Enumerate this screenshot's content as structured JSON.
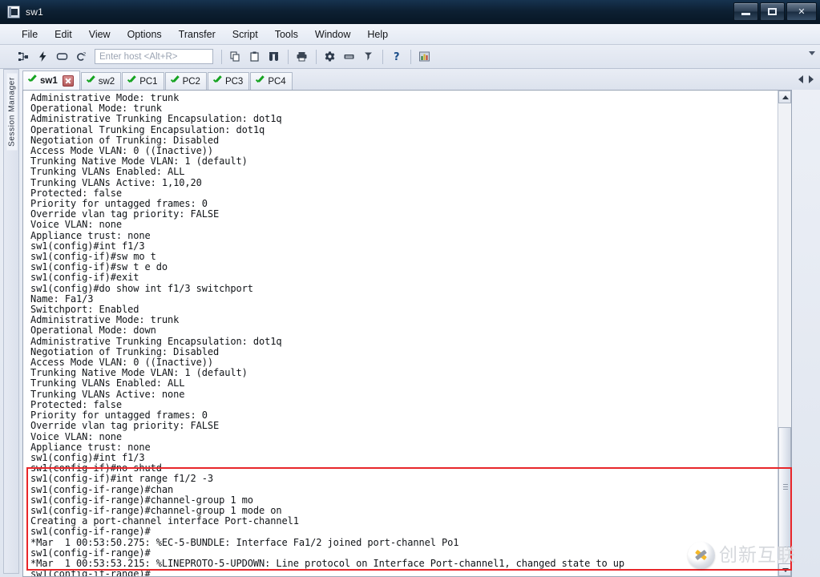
{
  "window": {
    "title": "sw1",
    "icon": "terminal-window-icon",
    "controls": {
      "minimize": "Minimize",
      "maximize": "Maximize",
      "close": "Close"
    }
  },
  "menubar": {
    "items": [
      "File",
      "Edit",
      "View",
      "Options",
      "Transfer",
      "Script",
      "Tools",
      "Window",
      "Help"
    ]
  },
  "toolbar": {
    "buttons": [
      {
        "name": "connect-icon",
        "glyph": "connect"
      },
      {
        "name": "quick-connect-icon",
        "glyph": "bolt"
      },
      {
        "name": "connect-in-tab-icon",
        "glyph": "tab-rect"
      },
      {
        "name": "reconnect-icon",
        "glyph": "c2"
      }
    ],
    "host_input": {
      "placeholder": "Enter host <Alt+R>",
      "value": ""
    },
    "right_buttons": [
      {
        "name": "copy-icon",
        "glyph": "copy"
      },
      {
        "name": "paste-icon",
        "glyph": "paste"
      },
      {
        "name": "find-icon",
        "glyph": "binoculars"
      },
      {
        "name": "print-icon",
        "glyph": "printer"
      },
      {
        "name": "settings-icon",
        "glyph": "gear"
      },
      {
        "name": "keymap-icon",
        "glyph": "keyboard"
      },
      {
        "name": "filter-icon",
        "glyph": "key"
      },
      {
        "name": "help-icon",
        "glyph": "question"
      },
      {
        "name": "session-options-icon",
        "glyph": "chart"
      }
    ],
    "overflow": "toolbar-overflow-arrow"
  },
  "sidebar": {
    "label": "Session Manager"
  },
  "tabs": {
    "items": [
      {
        "label": "sw1",
        "active": true,
        "status": "connected",
        "closable": true
      },
      {
        "label": "sw2",
        "active": false,
        "status": "connected",
        "closable": false
      },
      {
        "label": "PC1",
        "active": false,
        "status": "connected",
        "closable": false
      },
      {
        "label": "PC2",
        "active": false,
        "status": "connected",
        "closable": false
      },
      {
        "label": "PC3",
        "active": false,
        "status": "connected",
        "closable": false
      },
      {
        "label": "PC4",
        "active": false,
        "status": "connected",
        "closable": false
      }
    ],
    "nav_prev": "previous-tab",
    "nav_next": "next-tab"
  },
  "terminal": {
    "lines": [
      "Administrative Mode: trunk",
      "Operational Mode: trunk",
      "Administrative Trunking Encapsulation: dot1q",
      "Operational Trunking Encapsulation: dot1q",
      "Negotiation of Trunking: Disabled",
      "Access Mode VLAN: 0 ((Inactive))",
      "Trunking Native Mode VLAN: 1 (default)",
      "Trunking VLANs Enabled: ALL",
      "Trunking VLANs Active: 1,10,20",
      "Protected: false",
      "Priority for untagged frames: 0",
      "Override vlan tag priority: FALSE",
      "Voice VLAN: none",
      "Appliance trust: none",
      "sw1(config)#int f1/3",
      "sw1(config-if)#sw mo t",
      "sw1(config-if)#sw t e do",
      "sw1(config-if)#exit",
      "sw1(config)#do show int f1/3 switchport",
      "Name: Fa1/3",
      "Switchport: Enabled",
      "Administrative Mode: trunk",
      "Operational Mode: down",
      "Administrative Trunking Encapsulation: dot1q",
      "Negotiation of Trunking: Disabled",
      "Access Mode VLAN: 0 ((Inactive))",
      "Trunking Native Mode VLAN: 1 (default)",
      "Trunking VLANs Enabled: ALL",
      "Trunking VLANs Active: none",
      "Protected: false",
      "Priority for untagged frames: 0",
      "Override vlan tag priority: FALSE",
      "Voice VLAN: none",
      "Appliance trust: none",
      "sw1(config)#int f1/3",
      "sw1(config-if)#no shutd",
      "sw1(config-if)#int range f1/2 -3",
      "sw1(config-if-range)#chan",
      "sw1(config-if-range)#channel-group 1 mo",
      "sw1(config-if-range)#channel-group 1 mode on",
      "Creating a port-channel interface Port-channel1",
      "sw1(config-if-range)#",
      "*Mar  1 00:53:50.275: %EC-5-BUNDLE: Interface Fa1/2 joined port-channel Po1",
      "sw1(config-if-range)#",
      "*Mar  1 00:53:53.215: %LINEPROTO-5-UPDOWN: Line protocol on Interface Port-channel1, changed state to up",
      "sw1(config-if-range)#"
    ],
    "scrollbar": {
      "position": "near-bottom"
    }
  },
  "annotation": {
    "type": "red-rectangle",
    "color": "#e8262a"
  },
  "watermark": {
    "text": "创新互联"
  }
}
